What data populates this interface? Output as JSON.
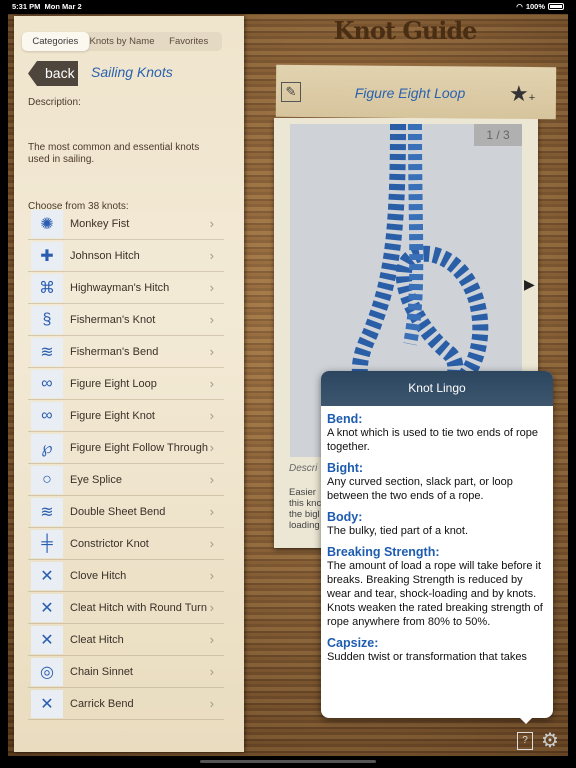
{
  "status": {
    "time": "5:31 PM",
    "date": "Mon Mar 2",
    "battery": "100%",
    "battery_level": 1.0
  },
  "app": {
    "title": "Knot Guide"
  },
  "sidebar": {
    "tabs": [
      {
        "label": "Categories",
        "selected": true
      },
      {
        "label": "Knots by Name"
      },
      {
        "label": "Favorites"
      }
    ],
    "back_label": "back",
    "category": "Sailing Knots",
    "description_label": "Description:",
    "description": "The most common and essential knots used in sailing.",
    "choose": "Choose from 38 knots:",
    "items": [
      {
        "label": "Monkey Fist"
      },
      {
        "label": "Johnson Hitch"
      },
      {
        "label": "Highwayman's Hitch"
      },
      {
        "label": "Fisherman's Knot"
      },
      {
        "label": "Fisherman's Bend"
      },
      {
        "label": "Figure Eight Loop"
      },
      {
        "label": "Figure Eight Knot"
      },
      {
        "label": "Figure Eight Follow Through"
      },
      {
        "label": "Eye Splice"
      },
      {
        "label": "Double Sheet Bend"
      },
      {
        "label": "Constrictor Knot"
      },
      {
        "label": "Clove Hitch"
      },
      {
        "label": "Cleat Hitch with Round Turn"
      },
      {
        "label": "Cleat Hitch"
      },
      {
        "label": "Chain Sinnet"
      },
      {
        "label": "Carrick Bend"
      }
    ]
  },
  "detail": {
    "title": "Figure Eight Loop",
    "page": "1 / 3",
    "description_label": "Descri",
    "text_lines": [
      "Easier",
      "this knc",
      "the bigl",
      "loading"
    ]
  },
  "popover": {
    "title": "Knot Lingo",
    "entries": [
      {
        "term": "Bend:",
        "def": "A knot which is used to tie two ends of rope together."
      },
      {
        "term": "Bight:",
        "def": "Any curved section, slack part, or loop between the two ends of a rope."
      },
      {
        "term": "Body:",
        "def": "The bulky, tied part of a knot."
      },
      {
        "term": "Breaking Strength:",
        "def": "The amount of load a rope will take before it breaks. Breaking Strength is reduced by wear and tear, shock-loading and by knots. Knots weaken the rated breaking strength of rope anywhere from 80% to 50%."
      },
      {
        "term": "Capsize:",
        "def": "Sudden twist or transformation that takes"
      }
    ]
  },
  "icons": {
    "edit": "pencil-icon",
    "favorite": "star-plus-icon",
    "help": "help-book-icon",
    "settings": "gear-icon"
  }
}
